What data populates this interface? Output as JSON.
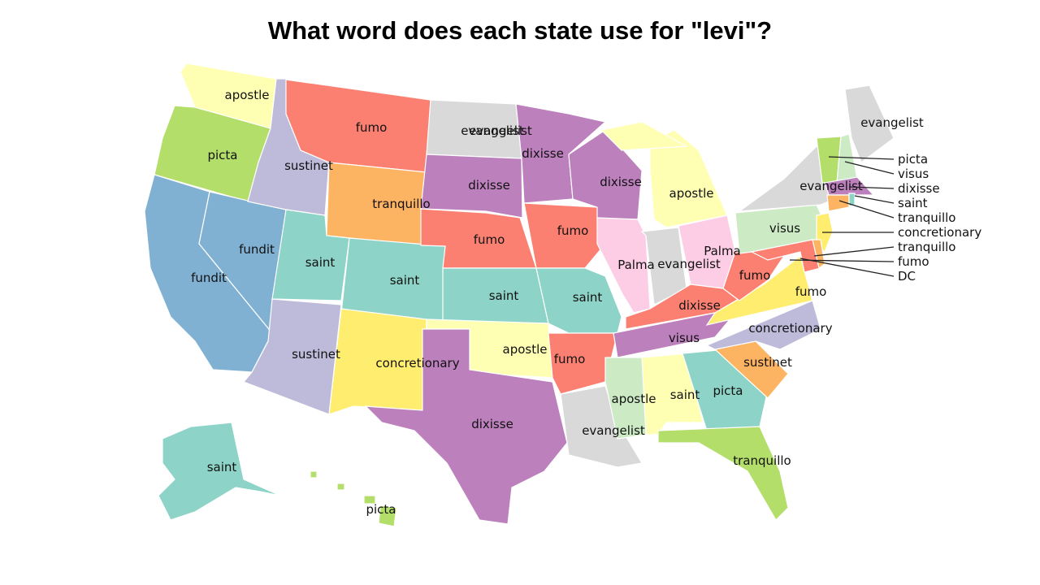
{
  "title": "What word does each state use for \"levi\"?",
  "palette": {
    "fumo": "#fb8072",
    "dixisse": "#bc80bd",
    "saint": "#8dd3c7",
    "apostle": "#ffffb3",
    "sustinet": "#bebada",
    "picta": "#b3de69",
    "tranquillo": "#fdb462",
    "concretionary": "#ffed6f",
    "evangelist": "#d9d9d9",
    "fundit": "#80b1d3",
    "Palma": "#fccde5",
    "visus": "#ccebc5"
  },
  "regions": [
    "apostle",
    "picta",
    "fundit",
    "fundit",
    "sustinet",
    "fumo",
    "tranquillo",
    "saint",
    "saint",
    "sustinet",
    "concretionary",
    "evangelist",
    "dixisse",
    "fumo",
    "saint",
    "apostle",
    "dixisse",
    "dixisse",
    "fumo",
    "saint",
    "fumo",
    "evangelist",
    "dixisse",
    "Palma",
    "apostle",
    "apostle",
    "evangelist",
    "Palma",
    "fumo",
    "dixisse",
    "visus",
    "apostle",
    "saint",
    "picta",
    "tranquillo",
    "sustinet",
    "concretionary",
    "fumo",
    "visus",
    "evangelist",
    "concretionary",
    "fumo",
    "tranquillo",
    "picta",
    "visus",
    "evangelist",
    "dixisse",
    "tranquillo",
    "saint",
    "saint",
    "picta",
    "picta",
    "picta",
    "picta"
  ],
  "labels": [
    "apostle",
    "picta",
    "fundit",
    "fundit",
    "sustinet",
    "fumo",
    "tranquillo",
    "saint",
    "saint",
    "sustinet",
    "concretionary",
    "evangelist",
    "dixisse",
    "fumo",
    "saint",
    "apostle",
    "dixisse",
    "dixisse",
    "fumo",
    "saint",
    "fumo",
    "evangelist",
    "dixisse",
    "Palma",
    "apostle",
    "evangelist",
    "Palma",
    "fumo",
    "dixisse",
    "visus",
    "apostle",
    "saint",
    "picta",
    "tranquillo",
    "sustinet",
    "concretionary",
    "fumo",
    "visus",
    "evangelist",
    "evangelist",
    "evangelist",
    "saint",
    "picta"
  ],
  "callouts": [
    "picta",
    "visus",
    "dixisse",
    "saint",
    "tranquillo",
    "concretionary",
    "tranquillo",
    "fumo",
    "DC"
  ]
}
